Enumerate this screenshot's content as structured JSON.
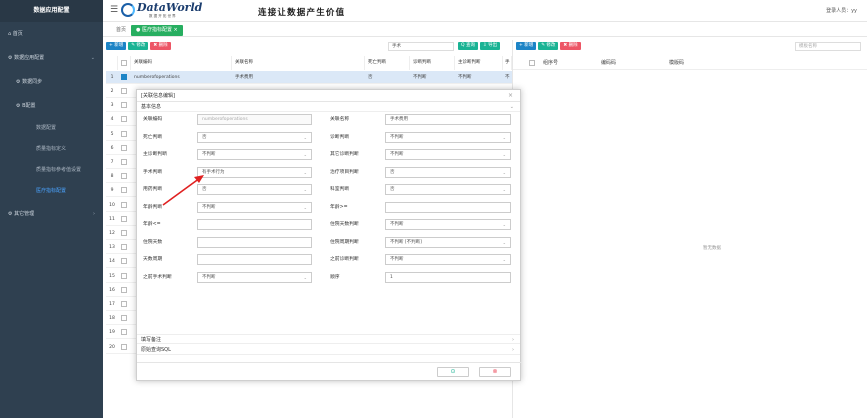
{
  "sidebar": {
    "title": "数据应用配置",
    "items": [
      "首页",
      "数据应用配置",
      "数据同步",
      "B配置",
      "其它管理"
    ],
    "subitems": [
      "数据配置",
      "质量指标定义",
      "质量指标参考值设置",
      "医疗指标配置"
    ]
  },
  "topbar": {
    "brand": "DataWorld",
    "brand_sub": "数 据 开 拓 世 界",
    "slogan": "连接让数据产生价值",
    "user": "登录人员：yy"
  },
  "tabs": [
    "首页",
    "医疗指标配置"
  ],
  "toolbar": {
    "add": "+ 新增",
    "edit": "✎ 修改",
    "delete": "✖ 删除"
  },
  "search": {
    "value": "手术",
    "query": "Q 查询",
    "export": "⇩ 导出",
    "right_placeholder": "模板名称"
  },
  "table": {
    "headers": [
      "关联编码",
      "关联名称",
      "死亡判断",
      "诊断判断",
      "主诊断判断",
      "手"
    ],
    "rows": [
      {
        "n": "1",
        "code": "numberofoperations",
        "name": "手术费用",
        "death": "否",
        "diag": "不判断",
        "main": "不判断",
        "extra": "不"
      }
    ],
    "rownums": [
      "2",
      "3",
      "4",
      "5",
      "6",
      "7",
      "8",
      "9",
      "10",
      "11",
      "12",
      "13",
      "14",
      "15",
      "16",
      "17",
      "18",
      "19",
      "20"
    ]
  },
  "right": {
    "headers": [
      "组序号",
      "编码码",
      "模版码"
    ],
    "empty": "暂无数据"
  },
  "modal": {
    "title": "[关联信息编辑]",
    "section": "基本信息",
    "fields": [
      {
        "l": "关联编码",
        "v": "numberofoperations",
        "ro": true
      },
      {
        "l": "关联名称",
        "v": "手术费用"
      },
      {
        "l": "死亡判断",
        "v": "否",
        "dd": true
      },
      {
        "l": "诊断判断",
        "v": "不判断",
        "dd": true
      },
      {
        "l": "主诊断判断",
        "v": "不判断",
        "dd": true
      },
      {
        "l": "其它诊断判断",
        "v": "不判断",
        "dd": true
      },
      {
        "l": "手术判断",
        "v": "有手术行为",
        "dd": true
      },
      {
        "l": "治疗项目判断",
        "v": "否",
        "dd": true
      },
      {
        "l": "用药判断",
        "v": "否",
        "dd": true
      },
      {
        "l": "科室判断",
        "v": "否",
        "dd": true
      },
      {
        "l": "年龄判断",
        "v": "不判断",
        "dd": true
      },
      {
        "l": "年龄>=",
        "v": ""
      },
      {
        "l": "年龄<=",
        "v": ""
      },
      {
        "l": "住院天数判断",
        "v": "不判断",
        "dd": true
      },
      {
        "l": "住院天数",
        "v": ""
      },
      {
        "l": "住院周期判断",
        "v": "不判断 [不判断]",
        "dd": true
      },
      {
        "l": "天数周期",
        "v": ""
      },
      {
        "l": "之前诊断判断",
        "v": "不判断",
        "dd": true
      },
      {
        "l": "之前手术判断",
        "v": "不判断",
        "dd": true
      },
      {
        "l": "顺序",
        "v": "1"
      }
    ],
    "sections": [
      "填写备注",
      "原始查询SQL"
    ],
    "ok": "⊙",
    "cancel": "⊗"
  },
  "colors": {
    "sidebar": "#2f4050",
    "blue": "#1c84c6",
    "green": "#1ab394",
    "red": "#ed5565"
  }
}
